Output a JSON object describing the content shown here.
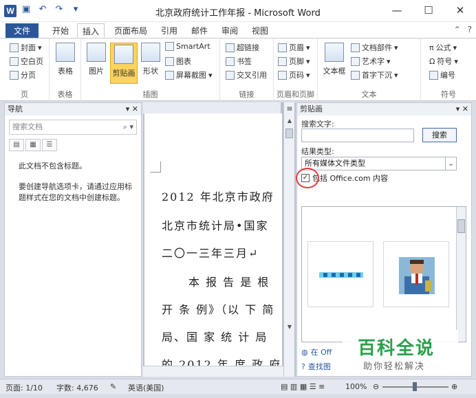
{
  "window": {
    "title": "北京政府统计工作年报 - Microsoft Word",
    "app_icon": "W",
    "qat": [
      "save-icon",
      "undo-icon",
      "redo-icon",
      "customize-icon"
    ],
    "controls": [
      "—",
      "☐",
      "✕"
    ]
  },
  "tabs": [
    "文件",
    "开始",
    "插入",
    "页面布局",
    "引用",
    "邮件",
    "审阅",
    "视图"
  ],
  "active_tab": "插入",
  "ribbon": {
    "pages": {
      "items": [
        "封面",
        "空白页",
        "分页"
      ],
      "label": "页"
    },
    "table": {
      "button": "表格",
      "label": "表格"
    },
    "illustrations": {
      "picture": "图片",
      "clipart": "剪贴画",
      "shapes": "形状",
      "smartart": "SmartArt",
      "chart": "图表",
      "screenshot": "屏幕截图",
      "label": "插图"
    },
    "links": {
      "items": [
        "超链接",
        "书签",
        "交叉引用"
      ],
      "label": "链接"
    },
    "header_footer": {
      "items": [
        "页眉",
        "页脚",
        "页码"
      ],
      "label": "页眉和页脚"
    },
    "text": {
      "textbox": "文本框",
      "items": [
        "文档部件",
        "艺术字",
        "首字下沉"
      ],
      "label": "文本"
    },
    "symbols": {
      "items": [
        "公式",
        "符号",
        "编号"
      ],
      "label": "符号"
    }
  },
  "nav": {
    "title": "导航",
    "search_placeholder": "搜索文档",
    "message1": "此文档不包含标题。",
    "message2": "要创建导航选项卡，请通过应用标题样式在您的文档中创建标题。"
  },
  "document": {
    "lines": [
      "2012 年北京市政府",
      "北京市统计局•国家",
      "二〇一三年三月↵",
      "本 报 告 是 根",
      "开 条 例》（以 下 简",
      "局、国 家 统 计 局",
      "的 2012 年 度 政 府"
    ]
  },
  "clipart": {
    "title": "剪贴画",
    "search_label": "搜索文字:",
    "search_value": "",
    "search_button": "搜索",
    "result_type_label": "结果类型:",
    "result_type_value": "所有媒体文件类型",
    "include_label": "包括 Office.com 内容",
    "include_checked": true,
    "link1": "在 Off",
    "link2": "查找图"
  },
  "watermark": {
    "title": "百科全说",
    "subtitle": "助你轻松解决"
  },
  "status": {
    "page": "页面: 1/10",
    "words": "字数: 4,676",
    "language": "英语(美国)",
    "zoom": "100%"
  }
}
